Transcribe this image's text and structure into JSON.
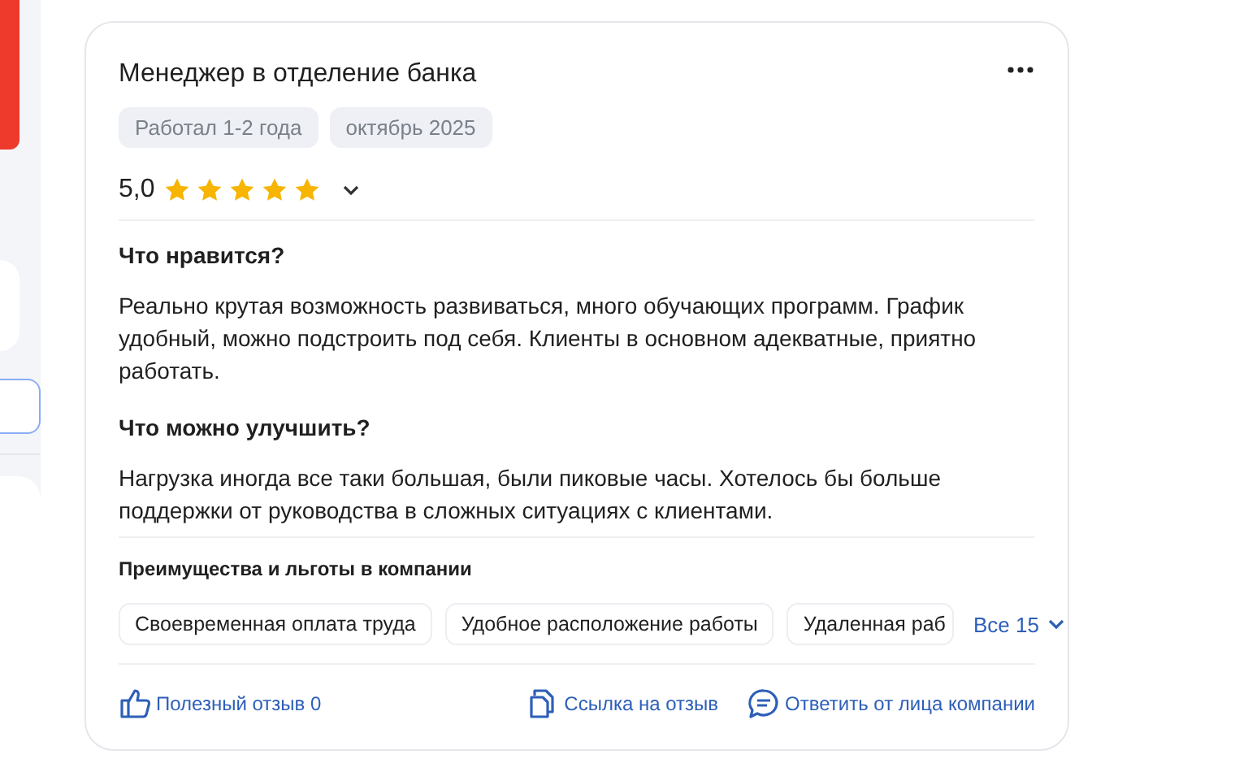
{
  "review": {
    "title": "Менеджер в отделение банка",
    "tags": [
      "Работал 1-2 года",
      "октябрь 2025"
    ],
    "rating": {
      "value": "5,0",
      "stars": 5
    },
    "sections": [
      {
        "heading": "Что нравится?",
        "text": "Реально крутая возможность развиваться, много обучающих программ. График удобный, можно подстроить под себя. Клиенты в основном адекватные, приятно работать."
      },
      {
        "heading": "Что можно улучшить?",
        "text": "Нагрузка иногда все таки большая, были пиковые часы. Хотелось бы больше поддержки от руководства в сложных ситуациях с клиентами."
      }
    ],
    "benefits": {
      "heading": "Преимущества и льготы в компании",
      "items": [
        "Своевременная оплата труда",
        "Удобное расположение работы",
        "Удаленная раб"
      ],
      "more": "Все 15"
    },
    "actions": [
      {
        "kind": "like",
        "label": "Полезный отзыв 0"
      },
      {
        "kind": "link",
        "label": "Ссылка на отзыв"
      },
      {
        "kind": "reply",
        "label": "Ответить от лица компании"
      }
    ]
  }
}
